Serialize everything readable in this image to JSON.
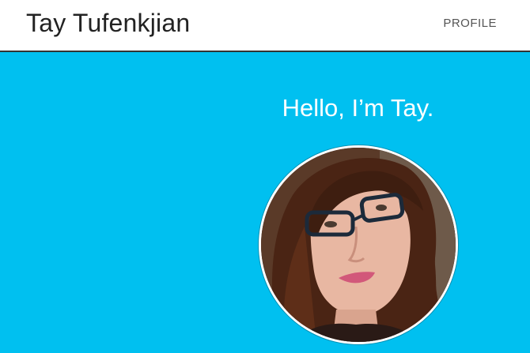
{
  "header": {
    "site_title": "Tay Tufenkjian",
    "nav_profile": "PROFILE"
  },
  "hero": {
    "greeting": "Hello, I’m Tay.",
    "avatar_alt": "Tay Tufenkjian profile photo"
  },
  "colors": {
    "hero_background": "#00c0f0",
    "header_background": "#ffffff",
    "header_border": "#333333"
  }
}
